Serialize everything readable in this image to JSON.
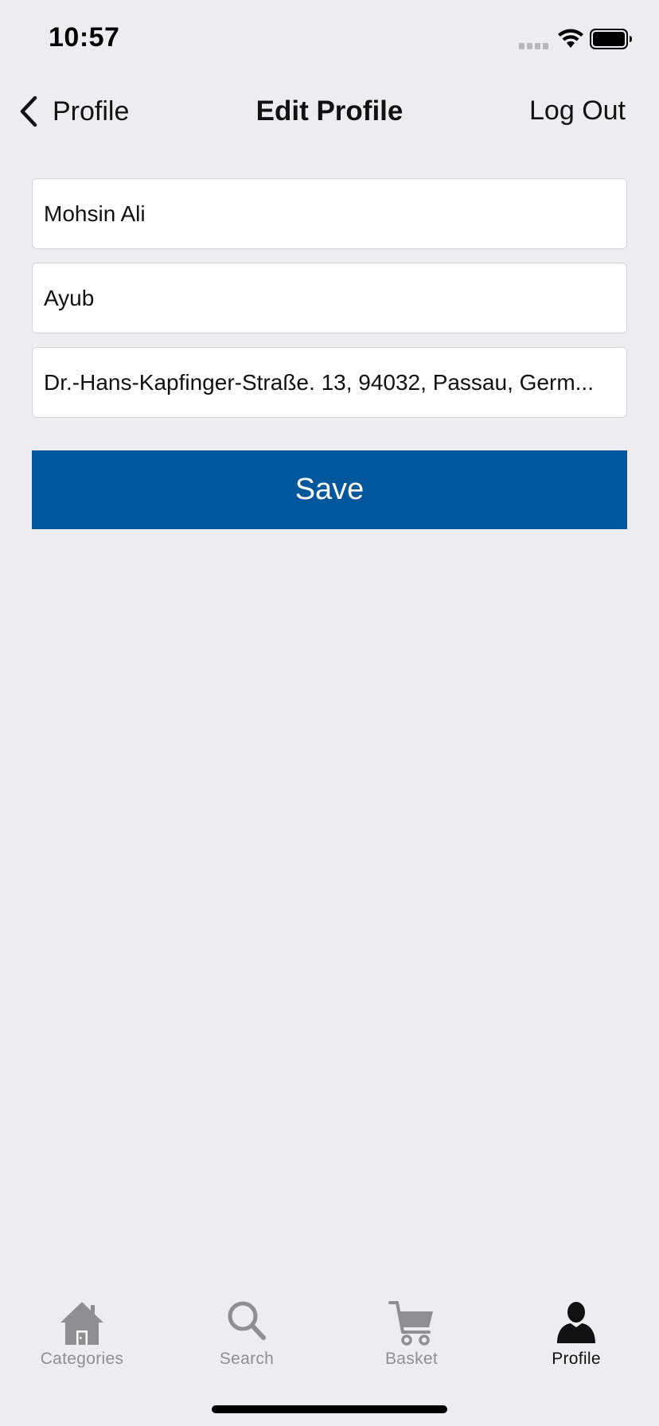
{
  "status_bar": {
    "time": "10:57"
  },
  "nav": {
    "back_label": "Profile",
    "title": "Edit Profile",
    "logout_label": "Log Out"
  },
  "form": {
    "first_name": "Mohsin Ali",
    "last_name": "Ayub",
    "address": "Dr.-Hans-Kapfinger-Straße. 13, 94032, Passau, Germ..."
  },
  "save_label": "Save",
  "tabs": [
    {
      "label": "Categories",
      "icon": "house-icon",
      "active": false
    },
    {
      "label": "Search",
      "icon": "magnifier-icon",
      "active": false
    },
    {
      "label": "Basket",
      "icon": "cart-icon",
      "active": false
    },
    {
      "label": "Profile",
      "icon": "person-icon",
      "active": true
    }
  ],
  "colors": {
    "background": "#edecf1",
    "accent": "#01579b",
    "tab_inactive": "#8e8e93",
    "tab_active": "#111111"
  }
}
